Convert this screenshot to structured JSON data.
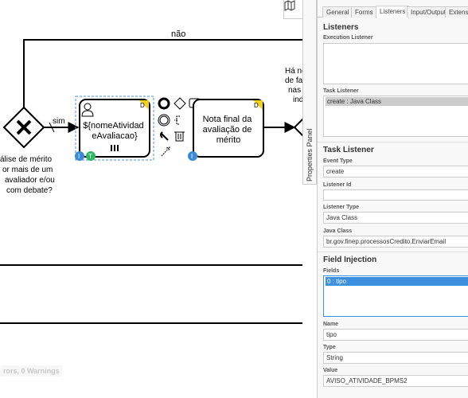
{
  "diagram": {
    "label_nao": "não",
    "label_sim": "sim",
    "gateway_left_question": [
      "álise de mérito",
      "or mais de um",
      "avaliador e/ou",
      "com debate?"
    ],
    "task_user_name": [
      "${nomeAtividad",
      "eAvaliacao}"
    ],
    "task_user_badge": "D",
    "task_final_name": [
      "Nota final da",
      "avaliação de",
      "mérito"
    ],
    "task_final_badge": "D",
    "gateway_right_question": [
      "Há nece",
      "de fazer",
      "nas ava",
      "individ"
    ],
    "marker_i": "I",
    "marker_t": "T"
  },
  "status": {
    "text": "rors, 0 Warnings"
  },
  "properties_toggle": {
    "label": "Properties Panel"
  },
  "panel": {
    "tabs": [
      "General",
      "Forms",
      "Listeners",
      "Input/Output",
      "Extensi"
    ],
    "listeners_title": "Listeners",
    "execution_listener_label": "Execution Listener",
    "task_listener_label": "Task Listener",
    "task_listener_items": [
      "create : Java Class"
    ],
    "task_listener_section_title": "Task Listener",
    "event_type_label": "Event Type",
    "event_type_value": "create",
    "listener_id_label": "Listener Id",
    "listener_id_value": "",
    "listener_type_label": "Listener Type",
    "listener_type_value": "Java Class",
    "java_class_label": "Java Class",
    "java_class_value": "br.gov.finep.processosCredito.EnviarEmail",
    "field_injection_title": "Field Injection",
    "fields_label": "Fields",
    "fields_items": [
      "0 : tipo"
    ],
    "name_label": "Name",
    "name_value": "tipo",
    "type_label": "Type",
    "type_value": "String",
    "value_label": "Value",
    "value_value": "AVISO_ATIVIDADE_BPMS2"
  }
}
